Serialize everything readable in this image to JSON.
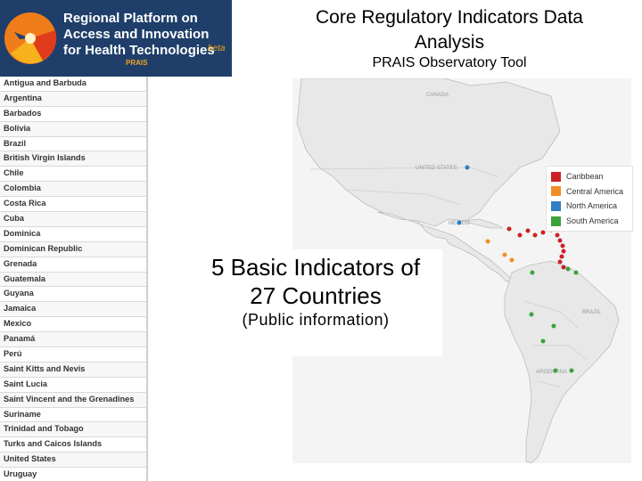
{
  "logo": {
    "text": "Regional Platform on Access and Innovation for Health Technologies",
    "line1": "Regional Platform on",
    "line2": "Access and Innovation",
    "line3": "for Health Technologies",
    "beta": "beta",
    "acronym": "PRAIS"
  },
  "header": {
    "title_line1": "Core Regulatory Indicators Data",
    "title_line2": "Analysis",
    "subtitle": "PRAIS Observatory Tool"
  },
  "countries": [
    "Antigua and Barbuda",
    "Argentina",
    "Barbados",
    "Bolivia",
    "Brazil",
    "British Virgin Islands",
    "Chile",
    "Colombia",
    "Costa Rica",
    "Cuba",
    "Dominica",
    "Dominican Republic",
    "Grenada",
    "Guatemala",
    "Guyana",
    "Jamaica",
    "Mexico",
    "Panamá",
    "Perú",
    "Saint Kitts and Nevis",
    "Saint Lucia",
    "Saint Vincent and the Grenadines",
    "Suriname",
    "Trinidad and Tobago",
    "Turks and Caicos Islands",
    "United States",
    "Uruguay"
  ],
  "legend": [
    {
      "label": "Caribbean",
      "color": "#cc2127"
    },
    {
      "label": "Central America",
      "color": "#f08e26"
    },
    {
      "label": "North America",
      "color": "#2f7fc1"
    },
    {
      "label": "South America",
      "color": "#3ca33a"
    }
  ],
  "map_labels": {
    "canada": "CANADA",
    "us": "UNITED STATES",
    "mexico": "MEXICO",
    "brazil": "BRAZIL",
    "argentina": "ARGENTINA"
  },
  "overlay": {
    "line1": "5 Basic Indicators of",
    "line2": "27 Countries",
    "line3": "(Public information)"
  }
}
